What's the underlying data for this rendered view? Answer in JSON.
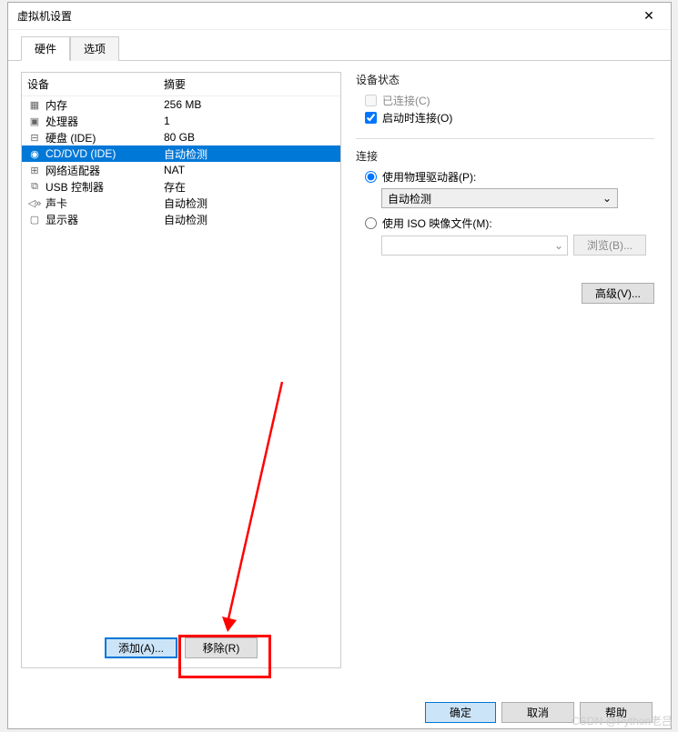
{
  "window": {
    "title": "虚拟机设置"
  },
  "tabs": {
    "hardware": "硬件",
    "options": "选项"
  },
  "columns": {
    "device": "设备",
    "summary": "摘要"
  },
  "devices": [
    {
      "icon": "▦",
      "name": "内存",
      "summary": "256 MB"
    },
    {
      "icon": "▣",
      "name": "处理器",
      "summary": "1"
    },
    {
      "icon": "⊟",
      "name": "硬盘 (IDE)",
      "summary": "80 GB"
    },
    {
      "icon": "◉",
      "name": "CD/DVD (IDE)",
      "summary": "自动检测"
    },
    {
      "icon": "⊞",
      "name": "网络适配器",
      "summary": "NAT"
    },
    {
      "icon": "⧉",
      "name": "USB 控制器",
      "summary": "存在"
    },
    {
      "icon": "◁»",
      "name": "声卡",
      "summary": "自动检测"
    },
    {
      "icon": "▢",
      "name": "显示器",
      "summary": "自动检测"
    }
  ],
  "selected_index": 3,
  "buttons": {
    "add": "添加(A)...",
    "remove": "移除(R)",
    "browse": "浏览(B)...",
    "advanced": "高级(V)...",
    "ok": "确定",
    "cancel": "取消",
    "help": "帮助"
  },
  "right": {
    "status_title": "设备状态",
    "connected": "已连接(C)",
    "connect_at_power": "启动时连接(O)",
    "connection_title": "连接",
    "use_physical": "使用物理驱动器(P):",
    "autodetect": "自动检测",
    "use_iso": "使用 ISO 映像文件(M):"
  },
  "watermark": "CSDN @Python老吕"
}
